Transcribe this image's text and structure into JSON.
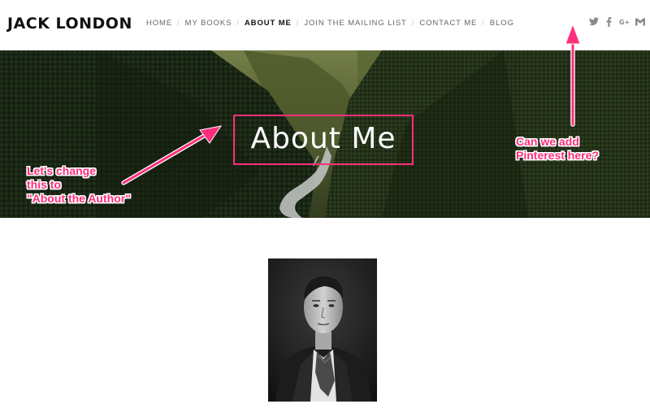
{
  "site": {
    "title": "JACK LONDON"
  },
  "nav": {
    "items": [
      {
        "label": "HOME",
        "active": false
      },
      {
        "label": "MY BOOKS",
        "active": false
      },
      {
        "label": "ABOUT ME",
        "active": true
      },
      {
        "label": "JOIN THE MAILING LIST",
        "active": false
      },
      {
        "label": "CONTACT ME",
        "active": false
      },
      {
        "label": "BLOG",
        "active": false
      }
    ],
    "separator": "/"
  },
  "social": [
    "twitter-icon",
    "facebook-icon",
    "google-plus-icon",
    "gmail-icon"
  ],
  "hero": {
    "title": "About Me"
  },
  "annotations": {
    "left": {
      "lines": [
        "Let's change",
        "this to",
        "\"About the Author\""
      ]
    },
    "right": {
      "lines": [
        "Can we add",
        "Pinterest here?"
      ]
    }
  },
  "colors": {
    "annotation": "#ff2e7a",
    "nav_text": "#666666",
    "nav_active": "#111111"
  }
}
